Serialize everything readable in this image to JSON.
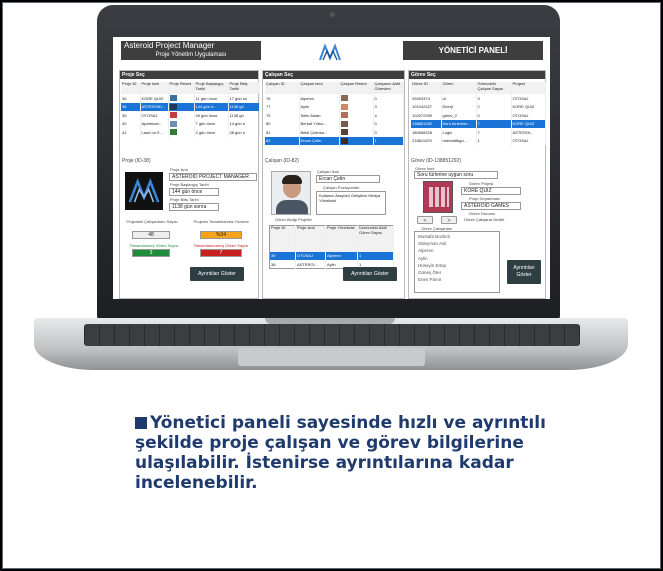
{
  "caption": {
    "line1": "Yönetici paneli sayesinde hızlı ve ayrıntılı",
    "line2": "şekilde proje çalışan ve görev bilgilerine",
    "line3": "ulaşılabilir. İstenirse ayrıntılarına kadar",
    "line4": "incelenebilir."
  },
  "app": {
    "title": "Asteroid Project Manager",
    "subtitle": "Proje Yönetim Uygulaması",
    "panel_title": "YÖNETİCİ PANELİ"
  },
  "projects": {
    "header": "Proje Seç",
    "columns": [
      "Proje ID",
      "Proje İsmi",
      "Proje Resmi",
      "Proje Başlangıç Tarihi",
      "Proje Bitiş Tarihi"
    ],
    "rows": [
      [
        "36",
        "KORE QUIZ",
        "",
        "11 gün önce",
        "17 gün sn"
      ],
      [
        "38",
        "ASTEROID...",
        "",
        "144 gün ö...",
        "1138 gü"
      ],
      [
        "39",
        "OTOSAJ",
        "",
        "49 gün önce",
        "1138 gü"
      ],
      [
        "40",
        "Apartman...",
        "",
        "7 gün önce",
        "14 gün s"
      ],
      [
        "41",
        "Land on E...",
        "",
        "2 gün önce",
        "38 gün s"
      ]
    ],
    "selected_row": 1,
    "detail_title": "Proje (ID-38)",
    "name_label": "Proje İsmi",
    "name_value": "ASTEROID PROJECT MANAGER",
    "start_label": "Proje Başlangıç Tarihi",
    "start_value": "144 gün önce",
    "end_label": "Proje Bitiş Tarihi",
    "end_value": "1138 gün sonra",
    "emp_count_label": "Projedeki Çalışanların Sayısı",
    "emp_count_value": "48",
    "completion_label": "Projenin Tamamlanma Yüzdesi",
    "completion_value": "%34",
    "done_tasks_label": "Tamamlanmış Görev Sayısı",
    "done_tasks_value": "3",
    "open_tasks_label": "Tamamlanmamış Görev Sayısı",
    "open_tasks_value": "7",
    "details_button": "Ayrıntıları Göster"
  },
  "employees": {
    "header": "Çalışan Seç",
    "columns": [
      "Çalışan ID",
      "Çalışan İsmi",
      "Çalışan Resmi",
      "Çalışanın Aktif Görevleri"
    ],
    "rows": [
      [
        "76",
        "Alperen",
        "",
        "0"
      ],
      [
        "77",
        "Aylin",
        "",
        "3"
      ],
      [
        "79",
        "Selin Aktan",
        "",
        "4"
      ],
      [
        "80",
        "Berkat Yıldız...",
        "",
        "0"
      ],
      [
        "81",
        "Bekil Çetinka...",
        "",
        "0"
      ],
      [
        "82",
        "Ercan Çetin",
        "",
        "1"
      ]
    ],
    "selected_row": 5,
    "detail_title": "Çalışan (ID-82)",
    "name_label": "Çalışan İsmi",
    "name_value": "Ercan Çetin",
    "position_label": "Çalışan Pozisyonları",
    "position_value": "Kullanıcı Arayüzü Geliştirici Medya Yöneticisi",
    "projects_label": "Görev Aldığı Projeler",
    "sub_columns": [
      "Proje ID",
      "Proje İsmi",
      "Proje Yöneticisi",
      "Üzerindeki Aktif Görev Sayısı"
    ],
    "sub_rows": [
      [
        "39",
        "OTOSAJ",
        "Alperen",
        "1"
      ],
      [
        "38",
        "ASTEROI...",
        "Aylin",
        "1"
      ]
    ],
    "details_button": "Ayrıntıları Göster"
  },
  "tasks": {
    "header": "Görev Seç",
    "columns": [
      "Görev ID",
      "Görev",
      "Görevdeki Çalışan Sayısı",
      "Projesi"
    ],
    "rows": [
      [
        "29493374",
        "UI",
        "3",
        "OTOSAJ"
      ],
      [
        "101042427",
        "Enerji",
        "2",
        "KORE QUIZ"
      ],
      [
        "102972399",
        "görev_2",
        "0",
        "OTOSAJ"
      ],
      [
        "138851292",
        "Soru türlerinin...",
        "7",
        "KORE QUIZ"
      ],
      [
        "180658328",
        "Login",
        "7",
        "ASTEROI..."
      ],
      [
        "218811029",
        "redetddfkgd...",
        "1",
        "OTOSAJ"
      ]
    ],
    "selected_row": 3,
    "detail_title": "Görev (ID-138851292)",
    "task_name_label": "Görev İsmi",
    "task_name_value": "Soru türlerine uygun soru",
    "project_label": "Görev Projesi",
    "project_value": "KORE QUIZ",
    "department_label": "Proje Departmanı",
    "department_value": "ASTEROID GAMES",
    "status_label": "Görev Durumu",
    "status_value": "Görev Çalışana Verildi.",
    "members_label": "Görev Çalışanları",
    "members": [
      "Mustafa Bozkırlı",
      "Süleyman Asil",
      "Alperen",
      "Aylin",
      "Hüseyin Ertaş",
      "Güneş Öter",
      "Enes Pamir"
    ],
    "details_button": "Ayrıntıları Göster",
    "nav_prev": "<",
    "nav_next": ">"
  },
  "colors": {
    "caption": "#1f3b6e",
    "header_bg": "#3e3e3e",
    "selection": "#1a73d6",
    "completion": "#f5a31a",
    "done": "#1e8c3a",
    "open": "#c8211f",
    "button": "#2f3e43"
  }
}
